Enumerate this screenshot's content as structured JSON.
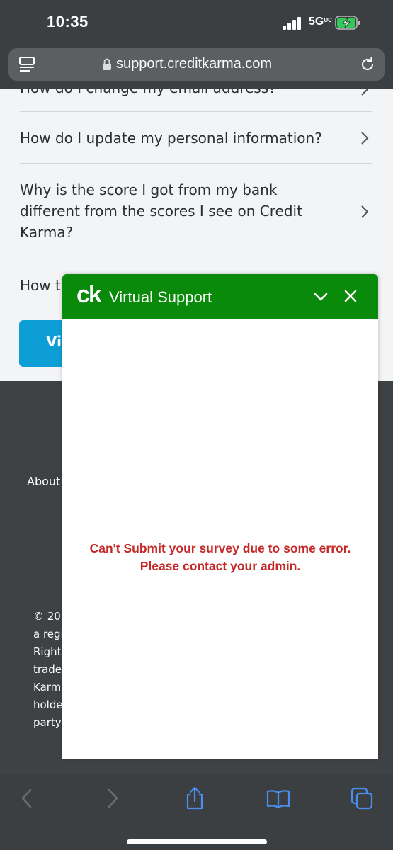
{
  "status_bar": {
    "time": "10:35",
    "network": "5G",
    "network_suffix": "UC"
  },
  "url_bar": {
    "url": "support.creditkarma.com"
  },
  "faq": [
    {
      "text": "How do I change my email address?"
    },
    {
      "text": "How do I update my personal information?"
    },
    {
      "text": "Why is the score I got from my bank different from the scores I see on Credit Karma?"
    },
    {
      "text": "How t"
    }
  ],
  "visit_button": {
    "label": "Vi"
  },
  "footer": {
    "about": "About",
    "copyright_lines": [
      "© 20",
      "a regi",
      "Right",
      "trade",
      "Karm",
      "holde",
      "party"
    ]
  },
  "chat": {
    "logo": "ck",
    "title": "Virtual Support",
    "error": "Can't Submit your survey due to some error. Please contact your admin.",
    "header_color": "#0a8a0a",
    "error_color": "#c62828"
  },
  "toolbar": {
    "icons": [
      "back-icon",
      "forward-icon",
      "share-icon",
      "bookmarks-icon",
      "tabs-icon"
    ],
    "accent": "#4a8ff0"
  }
}
